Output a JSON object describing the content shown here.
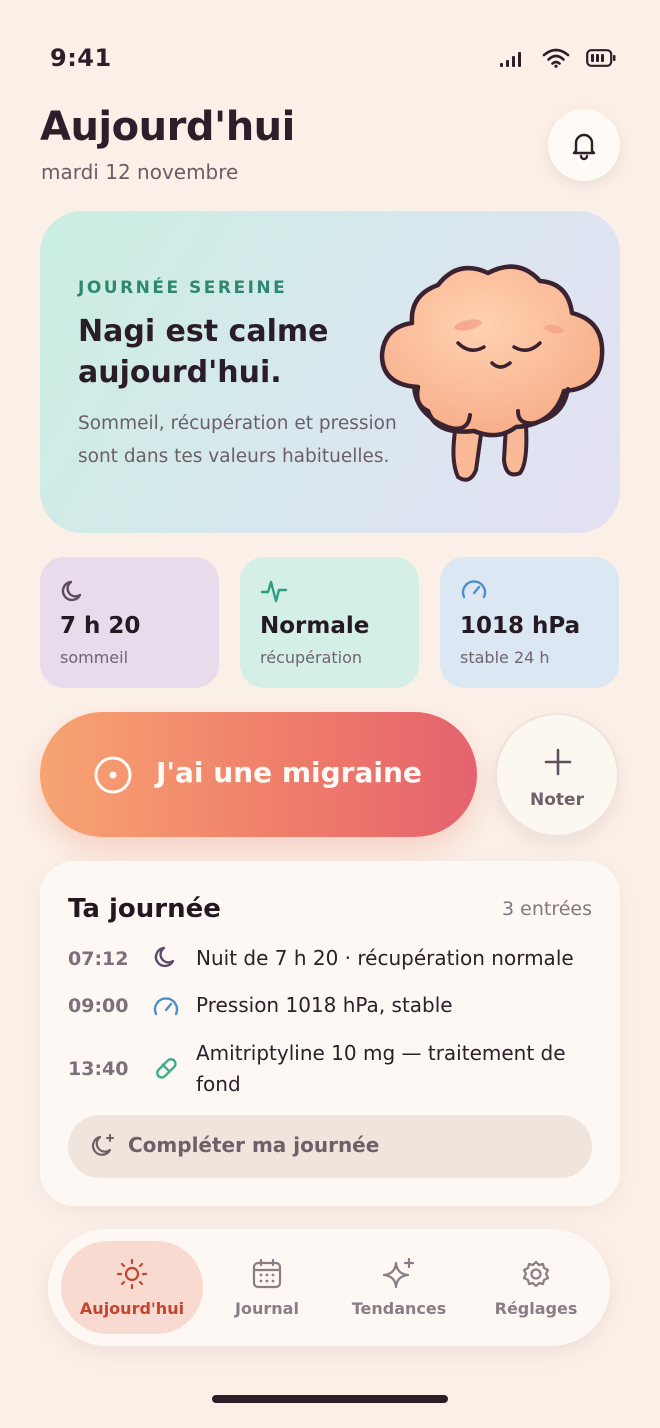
{
  "status_bar": {
    "time": "9:41"
  },
  "header": {
    "title": "Aujourd'hui",
    "date": "mardi 12 novembre"
  },
  "hero": {
    "kicker": "JOURNÉE SEREINE",
    "title": "Nagi est calme aujourd'hui.",
    "body": "Sommeil, récupération et pression sont dans tes valeurs habituelles."
  },
  "metrics": [
    {
      "value": "7 h 20",
      "label": "sommeil",
      "icon": "moon-icon"
    },
    {
      "value": "Normale",
      "label": "récupération",
      "icon": "heartbeat-icon"
    },
    {
      "value": "1018 hPa",
      "label": "stable 24 h",
      "icon": "gauge-icon"
    }
  ],
  "actions": {
    "migraine_label": "J'ai une migraine",
    "noter_label": "Noter"
  },
  "day": {
    "title": "Ta journée",
    "count": "3 entrées",
    "entries": [
      {
        "time": "07:12",
        "text": "Nuit de 7 h 20 · récupération normale",
        "icon": "moon-icon"
      },
      {
        "time": "09:00",
        "text": "Pression 1018 hPa, stable",
        "icon": "gauge-icon"
      },
      {
        "time": "13:40",
        "text": "Amitriptyline 10 mg — traitement de fond",
        "icon": "pill-icon"
      }
    ],
    "complete_label": "Compléter ma journée"
  },
  "tabs": [
    {
      "label": "Aujourd'hui",
      "icon": "sun-icon",
      "active": true
    },
    {
      "label": "Journal",
      "icon": "calendar-icon",
      "active": false
    },
    {
      "label": "Tendances",
      "icon": "sparkle-icon",
      "active": false
    },
    {
      "label": "Réglages",
      "icon": "gear-icon",
      "active": false
    }
  ],
  "colors": {
    "background": "#fbf0e8",
    "accent": "#c2452e",
    "migraine_gradient_start": "#f7a472",
    "migraine_gradient_end": "#e5626e",
    "hero_kicker": "#2f8770"
  }
}
